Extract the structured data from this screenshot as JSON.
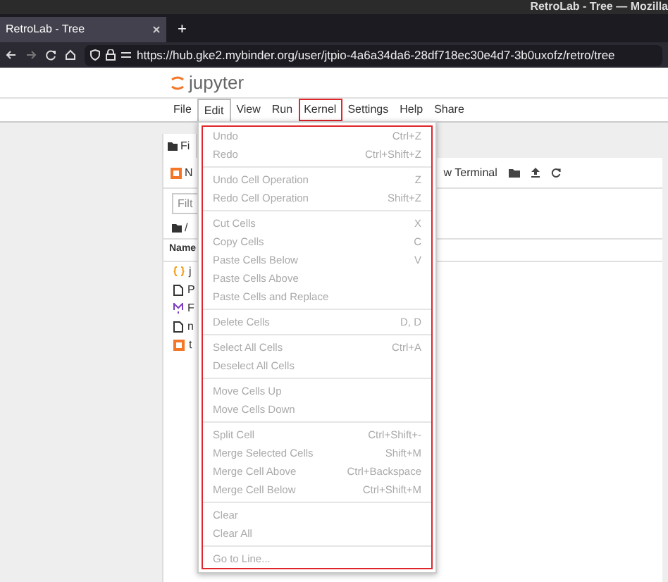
{
  "window": {
    "title": "RetroLab - Tree — Mozilla"
  },
  "browser": {
    "tabs": [
      {
        "label": "RetroLab - Tree",
        "selected": true
      }
    ],
    "new_tab": "+",
    "url": "https://hub.gke2.mybinder.org/user/jtpio-4a6a34da6-28df718ec30e4d7-3b0uxofz/retro/tree"
  },
  "app": {
    "logo_text": "jupyter"
  },
  "menubar": [
    {
      "label": "File",
      "selected": false,
      "highlighted": false
    },
    {
      "label": "Edit",
      "selected": true,
      "highlighted": false
    },
    {
      "label": "View",
      "selected": false,
      "highlighted": false
    },
    {
      "label": "Run",
      "selected": false,
      "highlighted": false
    },
    {
      "label": "Kernel",
      "selected": false,
      "highlighted": true
    },
    {
      "label": "Settings",
      "selected": false,
      "highlighted": false
    },
    {
      "label": "Help",
      "selected": false,
      "highlighted": false
    },
    {
      "label": "Share",
      "selected": false,
      "highlighted": false
    }
  ],
  "edit_menu": {
    "highlighted": true,
    "groups": [
      [
        {
          "label": "Undo",
          "shortcut": "Ctrl+Z",
          "disabled": true
        },
        {
          "label": "Redo",
          "shortcut": "Ctrl+Shift+Z",
          "disabled": true
        }
      ],
      [
        {
          "label": "Undo Cell Operation",
          "shortcut": "Z",
          "disabled": true
        },
        {
          "label": "Redo Cell Operation",
          "shortcut": "Shift+Z",
          "disabled": true
        }
      ],
      [
        {
          "label": "Cut Cells",
          "shortcut": "X",
          "disabled": true
        },
        {
          "label": "Copy Cells",
          "shortcut": "C",
          "disabled": true
        },
        {
          "label": "Paste Cells Below",
          "shortcut": "V",
          "disabled": true
        },
        {
          "label": "Paste Cells Above",
          "disabled": true
        },
        {
          "label": "Paste Cells and Replace",
          "disabled": true
        }
      ],
      [
        {
          "label": "Delete Cells",
          "shortcut": "D, D",
          "disabled": true
        }
      ],
      [
        {
          "label": "Select All Cells",
          "shortcut": "Ctrl+A",
          "disabled": true
        },
        {
          "label": "Deselect All Cells",
          "disabled": true
        }
      ],
      [
        {
          "label": "Move Cells Up",
          "disabled": true
        },
        {
          "label": "Move Cells Down",
          "disabled": true
        }
      ],
      [
        {
          "label": "Split Cell",
          "shortcut": "Ctrl+Shift+-",
          "disabled": true
        },
        {
          "label": "Merge Selected Cells",
          "shortcut": "Shift+M",
          "disabled": true
        },
        {
          "label": "Merge Cell Above",
          "shortcut": "Ctrl+Backspace",
          "disabled": true
        },
        {
          "label": "Merge Cell Below",
          "shortcut": "Ctrl+Shift+M",
          "disabled": true
        }
      ],
      [
        {
          "label": "Clear",
          "disabled": true
        },
        {
          "label": "Clear All",
          "disabled": true
        }
      ],
      [
        {
          "label": "Go to Line...",
          "disabled": true
        }
      ]
    ]
  },
  "file_panel": {
    "tab": "Fi",
    "new_button": "N",
    "filter_placeholder": "Filt",
    "path": "/",
    "column_header": "Name",
    "rows": [
      {
        "kind": "json",
        "name": "j"
      },
      {
        "kind": "file",
        "name": "P"
      },
      {
        "kind": "markdown",
        "name": "F"
      },
      {
        "kind": "file",
        "name": "n"
      },
      {
        "kind": "notebook",
        "name": "t"
      }
    ],
    "toolbar_text": "w Terminal"
  }
}
